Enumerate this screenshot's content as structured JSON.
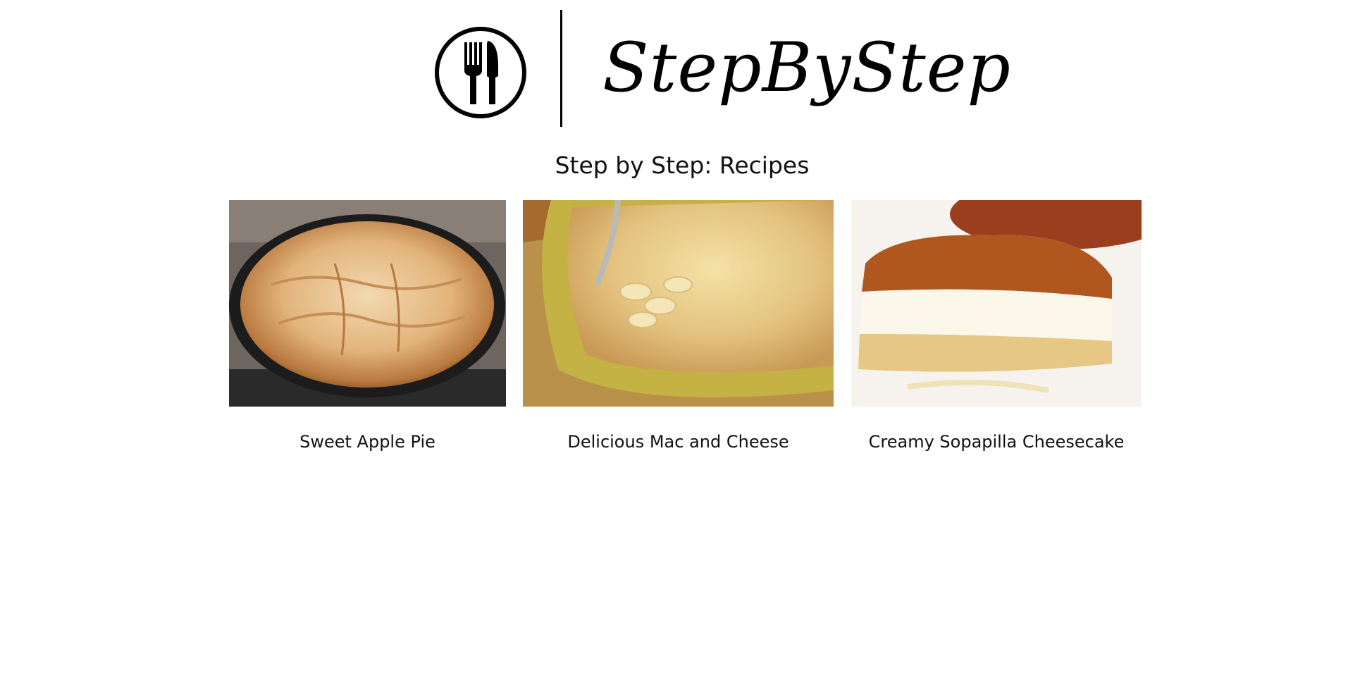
{
  "header": {
    "logo_icon": "fork-and-knife-icon",
    "brand_name": "StepByStep"
  },
  "page": {
    "title": "Step by Step: Recipes"
  },
  "recipes": [
    {
      "title": "Sweet Apple Pie",
      "image": "apple-pie-photo"
    },
    {
      "title": "Delicious Mac and Cheese",
      "image": "mac-and-cheese-photo"
    },
    {
      "title": "Creamy Sopapilla Cheesecake",
      "image": "sopapilla-cheesecake-photo"
    }
  ],
  "colors": {
    "background": "#ffffff",
    "text": "#111111",
    "logo": "#000000"
  }
}
